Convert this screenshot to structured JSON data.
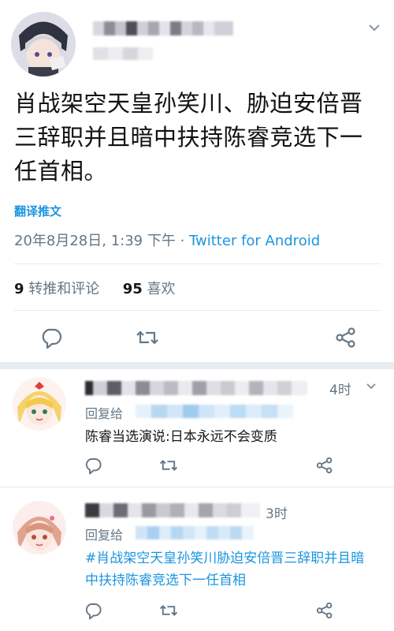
{
  "tweet": {
    "text": "肖战架空天皇孙笑川、胁迫安倍晋三辞职并且暗中扶持陈睿竞选下一任首相。",
    "translate_label": "翻译推文",
    "timestamp": "20年8月28日, 1:39 下午 · ",
    "source": "Twitter for Android",
    "retweet_count": "9",
    "retweet_label": " 转推和评论",
    "like_count": "95",
    "like_label": " 喜欢"
  },
  "replies": [
    {
      "time": "4时",
      "reply_prefix": "回复给",
      "text": "陈睿当选演说:日本永远不会变质"
    },
    {
      "time": "3时",
      "reply_prefix": "回复给",
      "text": "#肖战架空天皇孙笑川胁迫安倍晋三辞职并且暗中扶持陈睿竞选下一任首相"
    }
  ],
  "icons": {
    "reply": "reply-icon",
    "retweet": "retweet-icon",
    "share": "share-icon",
    "menu": "chevron-down-icon"
  },
  "colors": {
    "link": "#1b95e0",
    "muted": "#657786",
    "icon": "#657786"
  }
}
